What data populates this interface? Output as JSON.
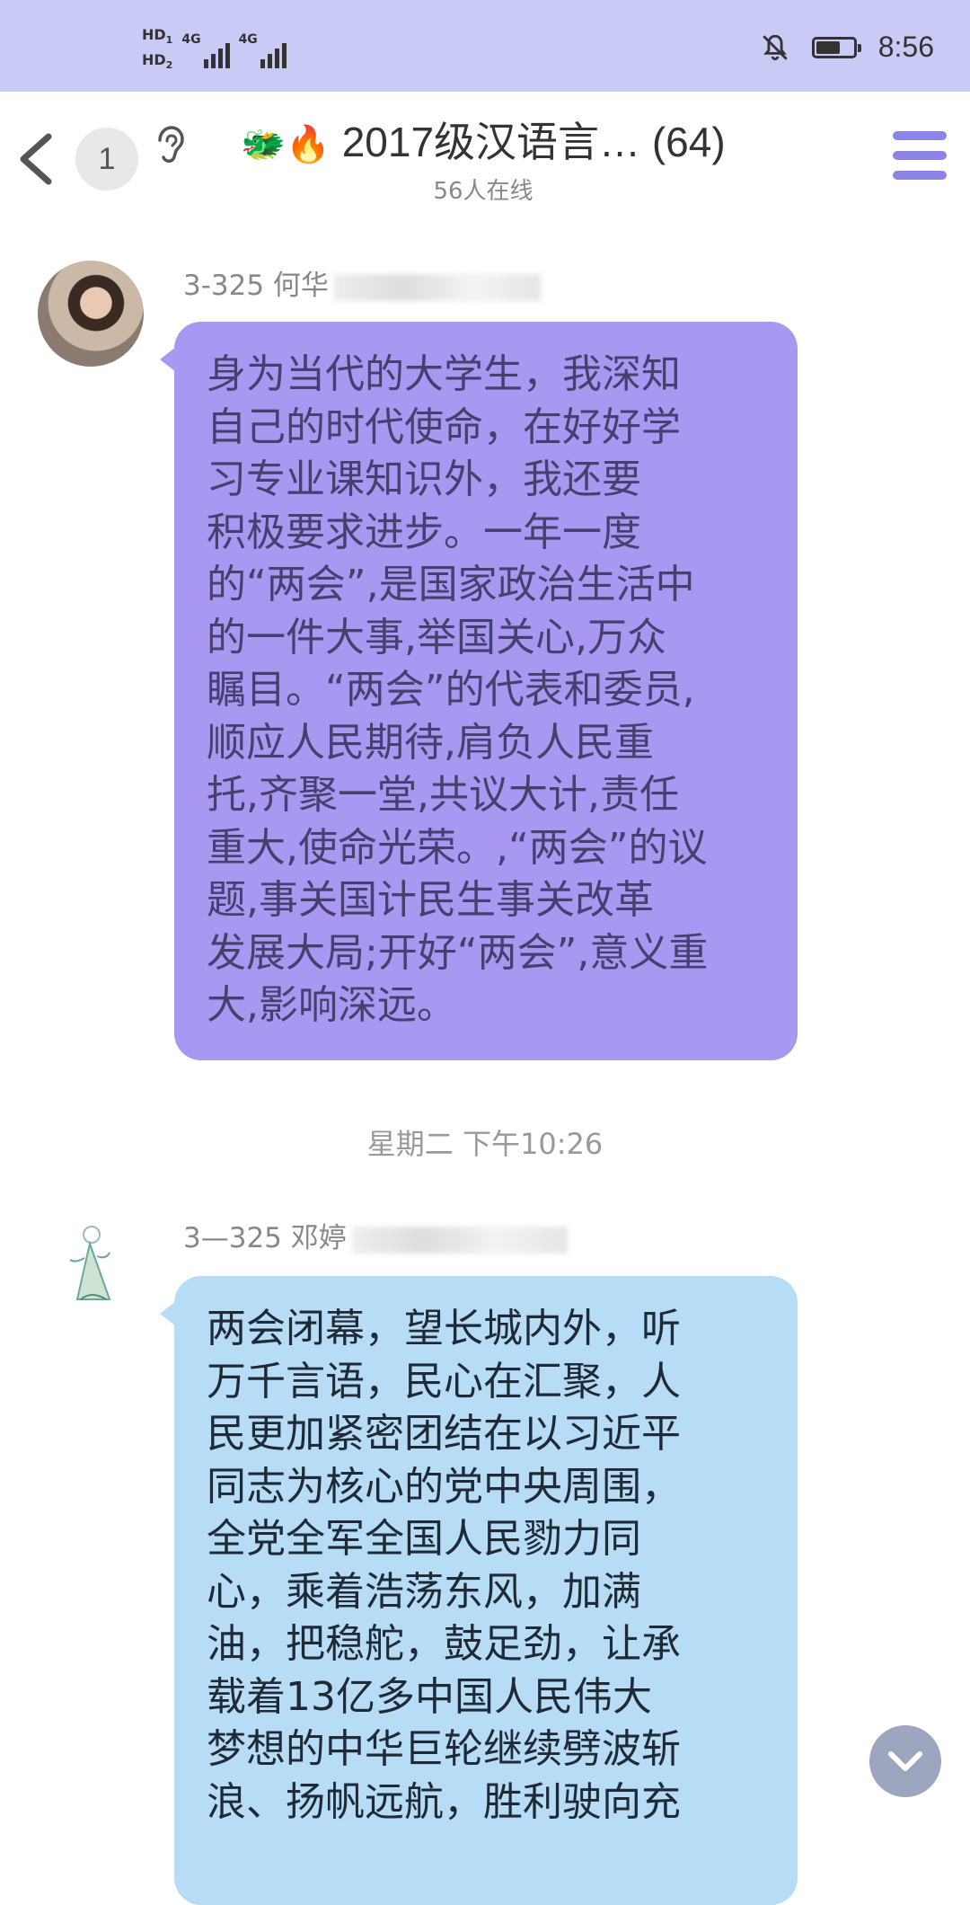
{
  "status_bar": {
    "hd1": "HD",
    "hd1_sub": "1",
    "hd2": "HD",
    "hd2_sub": "2",
    "net1": "4G",
    "net2": "4G",
    "time": "8:56"
  },
  "header": {
    "unread_count": "1",
    "title_emoji": "🐲🔥",
    "title": "2017级汉语言…",
    "member_count": "(64)",
    "online_status": "56人在线"
  },
  "messages": [
    {
      "sender": "3-325 何华",
      "text": "身为当代的大学生，我深知\n自己的时代使命，在好好学\n习专业课知识外，我还要\n积极要求进步。一年一度\n的“两会”,是国家政治生活中\n的一件大事,举国关心,万众\n瞩目。“两会”的代表和委员,\n顺应人民期待,肩负人民重\n托,齐聚一堂,共议大计,责任\n重大,使命光荣。,“两会”的议\n题,事关国计民生事关改革\n发展大局;开好“两会”,意义重\n大,影响深远。"
    },
    {
      "sender": "3—325 邓婷",
      "text": "两会闭幕，望长城内外，听\n万千言语，民心在汇聚，人\n民更加紧密团结在以习近平\n同志为核心的党中央周围，\n全党全军全国人民勠力同\n心，乘着浩荡东风，加满\n油，把稳舵，鼓足劲，让承\n载着13亿多中国人民伟大\n梦想的中华巨轮继续劈波斩\n浪、扬帆远航，胜利驶向充"
    }
  ],
  "timestamp": "星期二 下午10:26",
  "colors": {
    "status_bar_bg": "#c9caf5",
    "bubble1_bg": "#a898f1",
    "bubble2_bg": "#b7ddf6",
    "menu_accent": "#8b83e6"
  },
  "icons": [
    "back-arrow-icon",
    "hearing-ear-icon",
    "menu-icon",
    "mute-bell-icon",
    "battery-icon",
    "signal-icon",
    "chevron-down-icon"
  ]
}
